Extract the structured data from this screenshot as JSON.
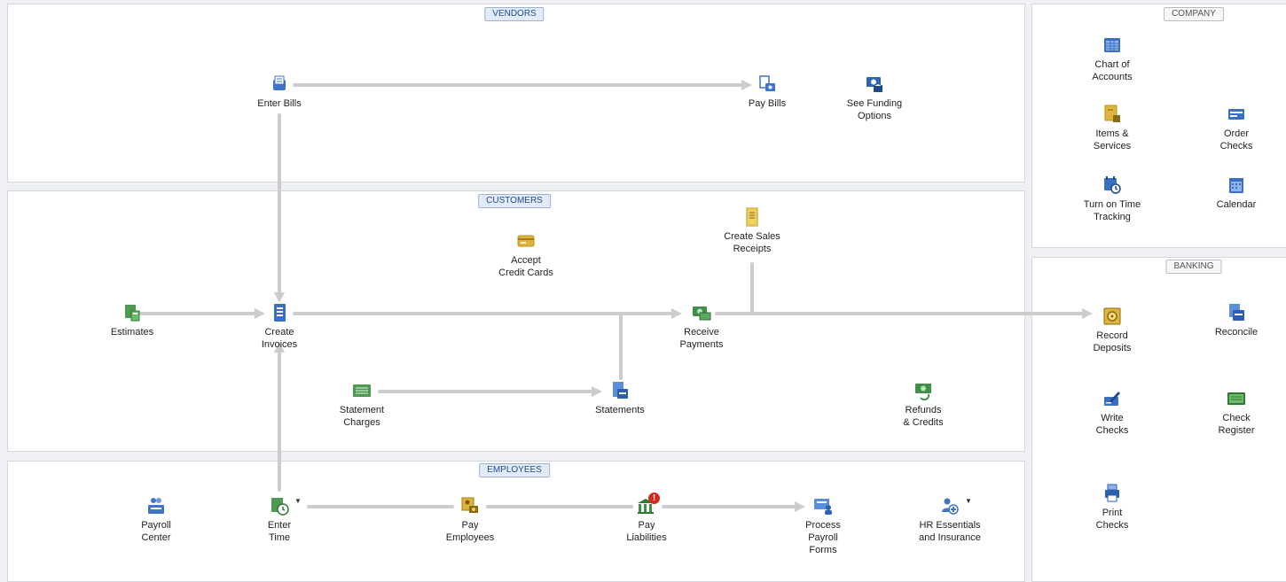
{
  "sections": {
    "vendors": "VENDORS",
    "customers": "CUSTOMERS",
    "employees": "EMPLOYEES",
    "company": "COMPANY",
    "banking": "BANKING"
  },
  "vendors": {
    "enter_bills": "Enter Bills",
    "pay_bills": "Pay Bills",
    "see_funding": "See Funding\nOptions"
  },
  "customers": {
    "accept_cc": "Accept\nCredit Cards",
    "create_sales_receipts": "Create Sales\nReceipts",
    "estimates": "Estimates",
    "create_invoices": "Create\nInvoices",
    "receive_payments": "Receive\nPayments",
    "statement_charges": "Statement\nCharges",
    "statements": "Statements",
    "refunds_credits": "Refunds\n& Credits"
  },
  "employees": {
    "payroll_center": "Payroll\nCenter",
    "enter_time": "Enter\nTime",
    "pay_employees": "Pay\nEmployees",
    "pay_liabilities": "Pay\nLiabilities",
    "process_payroll_forms": "Process\nPayroll\nForms",
    "hr_essentials": "HR Essentials\nand Insurance"
  },
  "company": {
    "chart_of_accounts": "Chart of\nAccounts",
    "items_services": "Items &\nServices",
    "order_checks": "Order\nChecks",
    "turn_on_time": "Turn on Time\nTracking",
    "calendar": "Calendar"
  },
  "banking": {
    "record_deposits": "Record\nDeposits",
    "reconcile": "Reconcile",
    "write_checks": "Write\nChecks",
    "check_register": "Check\nRegister",
    "print_checks": "Print\nChecks"
  },
  "alert_badge": "!"
}
